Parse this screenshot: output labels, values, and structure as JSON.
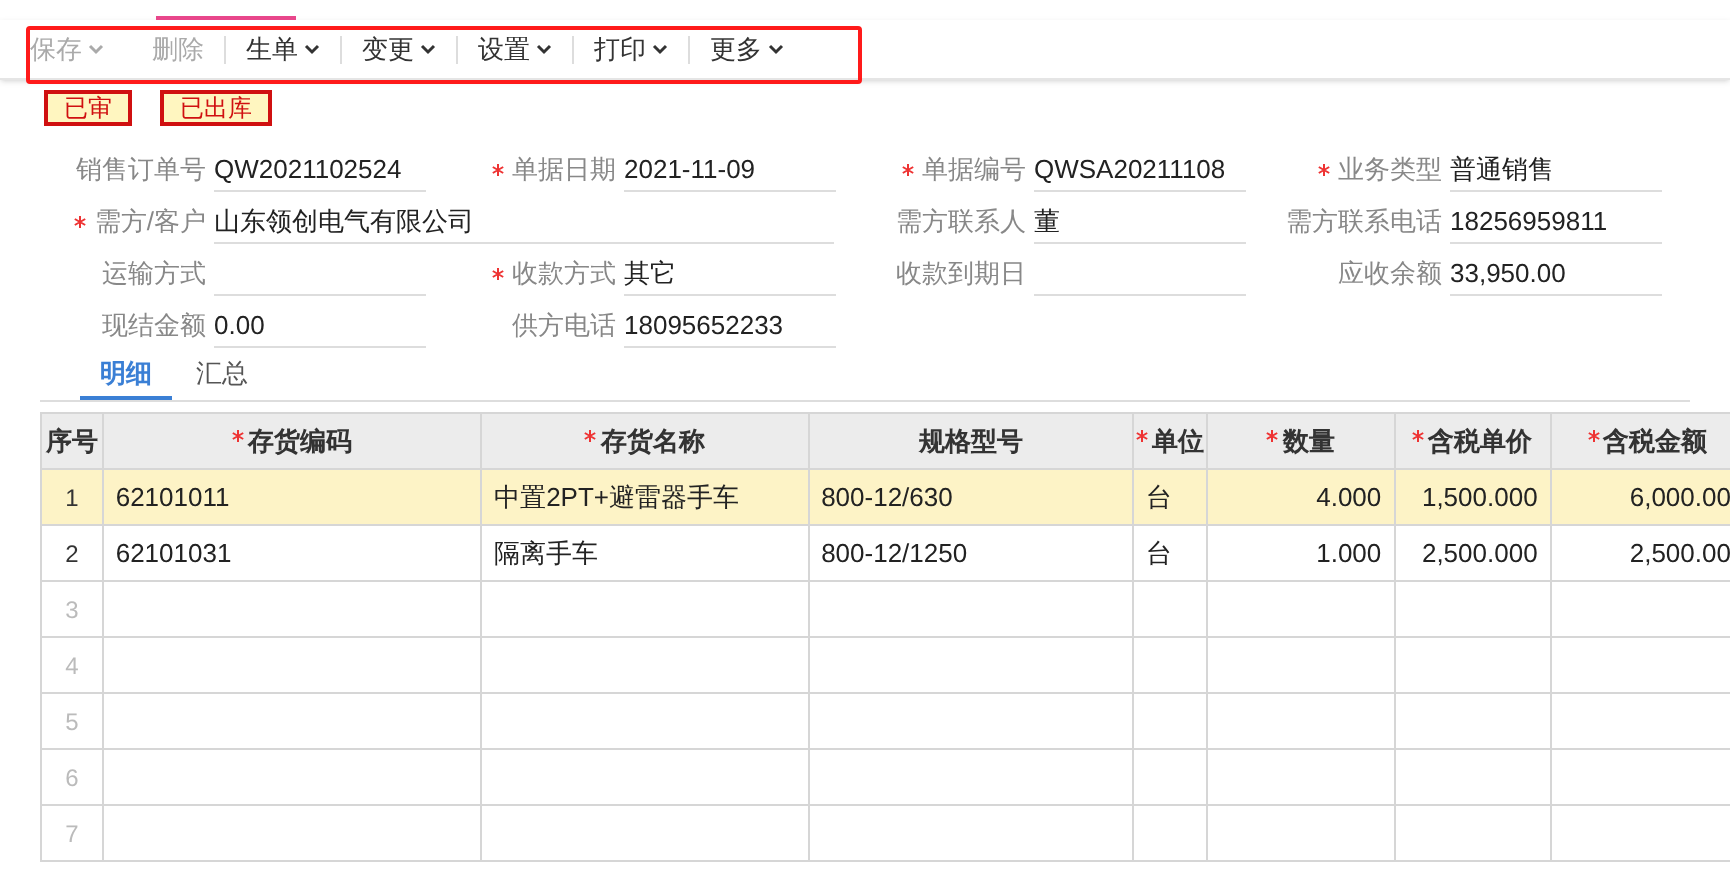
{
  "toolbar": [
    {
      "label": "保存",
      "dropdown": true,
      "disabled": true
    },
    {
      "label": "删除",
      "dropdown": false,
      "disabled": true
    },
    {
      "label": "生单",
      "dropdown": true,
      "disabled": false
    },
    {
      "label": "变更",
      "dropdown": true,
      "disabled": false
    },
    {
      "label": "设置",
      "dropdown": true,
      "disabled": false
    },
    {
      "label": "打印",
      "dropdown": true,
      "disabled": false
    },
    {
      "label": "更多",
      "dropdown": true,
      "disabled": false
    }
  ],
  "stamps": [
    "已审",
    "已出库"
  ],
  "form_fields": [
    {
      "label": "销售订单号",
      "required": false,
      "value": "QW2021102524"
    },
    {
      "label": "单据日期",
      "required": true,
      "value": "2021-11-09"
    },
    {
      "label": "单据编号",
      "required": true,
      "value": "QWSA20211108"
    },
    {
      "label": "业务类型",
      "required": true,
      "value": "普通销售"
    },
    {
      "label": "需方/客户",
      "required": true,
      "value": "山东领创电气有限公司",
      "wide": true
    },
    {
      "label": "需方联系人",
      "required": false,
      "value": "董"
    },
    {
      "label": "需方联系电话",
      "required": false,
      "value": "18256959811"
    },
    {
      "label": "运输方式",
      "required": false
    },
    {
      "label": "收款方式",
      "required": true,
      "value": "其它"
    },
    {
      "label": "收款到期日",
      "required": false
    },
    {
      "label": "应收余额",
      "required": false,
      "value": "33,950.00"
    },
    {
      "label": "现结金额",
      "required": false,
      "value": "0.00"
    },
    {
      "label": "供方电话",
      "required": false,
      "value": "18095652233"
    }
  ],
  "detail_tabs": [
    {
      "label": "明细",
      "selected": true
    },
    {
      "label": "汇总",
      "selected": false
    }
  ],
  "table": {
    "columns": [
      {
        "label": "序号",
        "required": false
      },
      {
        "label": "存货编码",
        "required": true
      },
      {
        "label": "存货名称",
        "required": true
      },
      {
        "label": "规格型号",
        "required": false
      },
      {
        "label": "单位",
        "required": true
      },
      {
        "label": "数量",
        "required": true
      },
      {
        "label": "含税单价",
        "required": true
      },
      {
        "label": "含税金额",
        "required": true
      }
    ],
    "rows": [
      {
        "selected": true,
        "cells": [
          "1",
          "62101011",
          "中置2PT+避雷器手车",
          "800-12/630",
          "台",
          "4.000",
          "1,500.000",
          "6,000.00"
        ]
      },
      {
        "selected": false,
        "cells": [
          "2",
          "62101031",
          "隔离手车",
          "800-12/1250",
          "台",
          "1.000",
          "2,500.000",
          "2,500.00"
        ]
      },
      {
        "selected": false,
        "cells": [
          "3"
        ]
      },
      {
        "selected": false,
        "cells": [
          "4"
        ]
      },
      {
        "selected": false,
        "cells": [
          "5"
        ]
      },
      {
        "selected": false,
        "cells": [
          "6"
        ]
      },
      {
        "selected": false,
        "cells": [
          "7"
        ]
      }
    ]
  }
}
